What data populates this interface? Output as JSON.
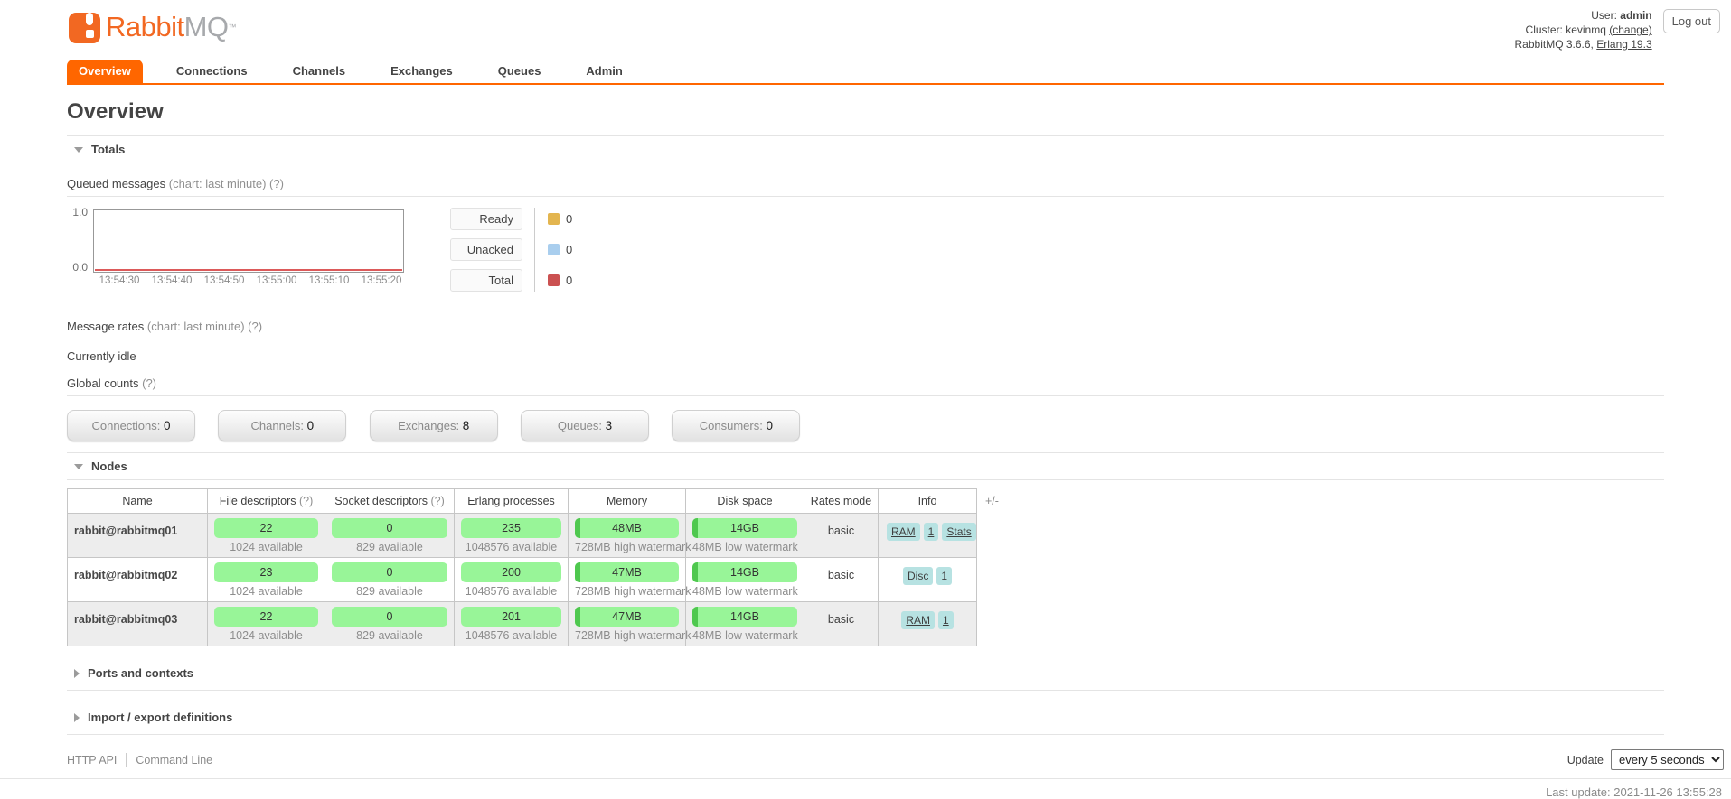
{
  "header": {
    "logo": {
      "primary": "Rabbit",
      "secondary": "MQ",
      "trademark": "™"
    },
    "user_label": "User:",
    "user_value": "admin",
    "cluster_label": "Cluster:",
    "cluster_value": "kevinmq",
    "cluster_change_link": "(change)",
    "version_prefix": "RabbitMQ 3.6.6,",
    "erlang_link": "Erlang 19.3",
    "logout_label": "Log out"
  },
  "tabs": [
    {
      "label": "Overview",
      "active": true
    },
    {
      "label": "Connections",
      "active": false
    },
    {
      "label": "Channels",
      "active": false
    },
    {
      "label": "Exchanges",
      "active": false
    },
    {
      "label": "Queues",
      "active": false
    },
    {
      "label": "Admin",
      "active": false
    }
  ],
  "page_title": "Overview",
  "totals": {
    "section_title": "Totals",
    "queued": {
      "title": "Queued messages",
      "hint": "(chart: last minute)",
      "help": "(?)"
    },
    "legend": [
      {
        "label": "Ready",
        "value": "0",
        "color": "#e3b54f"
      },
      {
        "label": "Unacked",
        "value": "0",
        "color": "#a9ceee"
      },
      {
        "label": "Total",
        "value": "0",
        "color": "#cb5151"
      }
    ],
    "rates": {
      "title": "Message rates",
      "hint": "(chart: last minute)",
      "help": "(?)"
    },
    "idle_text": "Currently idle",
    "global_counts": {
      "title": "Global counts",
      "help": "(?)"
    },
    "counts": [
      {
        "label": "Connections:",
        "value": "0"
      },
      {
        "label": "Channels:",
        "value": "0"
      },
      {
        "label": "Exchanges:",
        "value": "8"
      },
      {
        "label": "Queues:",
        "value": "3"
      },
      {
        "label": "Consumers:",
        "value": "0"
      }
    ]
  },
  "chart_data": {
    "type": "line",
    "title": "Queued messages (chart: last minute)",
    "x_ticks": [
      "13:54:30",
      "13:54:40",
      "13:54:50",
      "13:55:00",
      "13:55:10",
      "13:55:20"
    ],
    "ylim": [
      0.0,
      1.0
    ],
    "ymax_label": "1.0",
    "ymin_label": "0.0",
    "grid": false,
    "legend_position": "right",
    "series": [
      {
        "name": "Ready",
        "color": "#e3b54f",
        "values": [
          0,
          0,
          0,
          0,
          0,
          0
        ]
      },
      {
        "name": "Unacked",
        "color": "#a9ceee",
        "values": [
          0,
          0,
          0,
          0,
          0,
          0
        ]
      },
      {
        "name": "Total",
        "color": "#cb5151",
        "values": [
          0,
          0,
          0,
          0,
          0,
          0
        ]
      }
    ]
  },
  "nodes": {
    "section_title": "Nodes",
    "expander": "+/-",
    "table": {
      "columns": [
        {
          "label": "Name",
          "help": ""
        },
        {
          "label": "File descriptors",
          "help": "(?)"
        },
        {
          "label": "Socket descriptors",
          "help": "(?)"
        },
        {
          "label": "Erlang processes",
          "help": ""
        },
        {
          "label": "Memory",
          "help": ""
        },
        {
          "label": "Disk space",
          "help": ""
        },
        {
          "label": "Rates mode",
          "help": ""
        },
        {
          "label": "Info",
          "help": ""
        }
      ],
      "rows": [
        {
          "name": "rabbit@rabbitmq01",
          "fd": {
            "value": "22",
            "sub": "1024 available"
          },
          "sd": {
            "value": "0",
            "sub": "829 available"
          },
          "proc": {
            "value": "235",
            "sub": "1048576 available"
          },
          "mem": {
            "value": "48MB",
            "sub": "728MB high watermark"
          },
          "disk": {
            "value": "14GB",
            "sub": "48MB low watermark"
          },
          "rates_mode": "basic",
          "badges": [
            "RAM",
            "1",
            "Stats"
          ]
        },
        {
          "name": "rabbit@rabbitmq02",
          "fd": {
            "value": "23",
            "sub": "1024 available"
          },
          "sd": {
            "value": "0",
            "sub": "829 available"
          },
          "proc": {
            "value": "200",
            "sub": "1048576 available"
          },
          "mem": {
            "value": "47MB",
            "sub": "728MB high watermark"
          },
          "disk": {
            "value": "14GB",
            "sub": "48MB low watermark"
          },
          "rates_mode": "basic",
          "badges": [
            "Disc",
            "1"
          ]
        },
        {
          "name": "rabbit@rabbitmq03",
          "fd": {
            "value": "22",
            "sub": "1024 available"
          },
          "sd": {
            "value": "0",
            "sub": "829 available"
          },
          "proc": {
            "value": "201",
            "sub": "1048576 available"
          },
          "mem": {
            "value": "47MB",
            "sub": "728MB high watermark"
          },
          "disk": {
            "value": "14GB",
            "sub": "48MB low watermark"
          },
          "rates_mode": "basic",
          "badges": [
            "RAM",
            "1"
          ]
        }
      ]
    }
  },
  "sections": [
    {
      "title": "Ports and contexts"
    },
    {
      "title": "Import / export definitions"
    }
  ],
  "footer": {
    "links": [
      "HTTP API",
      "Command Line"
    ],
    "update_label": "Update",
    "update_value": "every 5 seconds",
    "last_update": "Last update: 2021-11-26 13:55:28"
  },
  "colors": {
    "accent_orange": "#ff6600",
    "logo_orange": "#f26822",
    "bar_green": "#98f598",
    "bar_green_dark": "#4fc84f",
    "badge_teal": "#b7e2e2"
  }
}
